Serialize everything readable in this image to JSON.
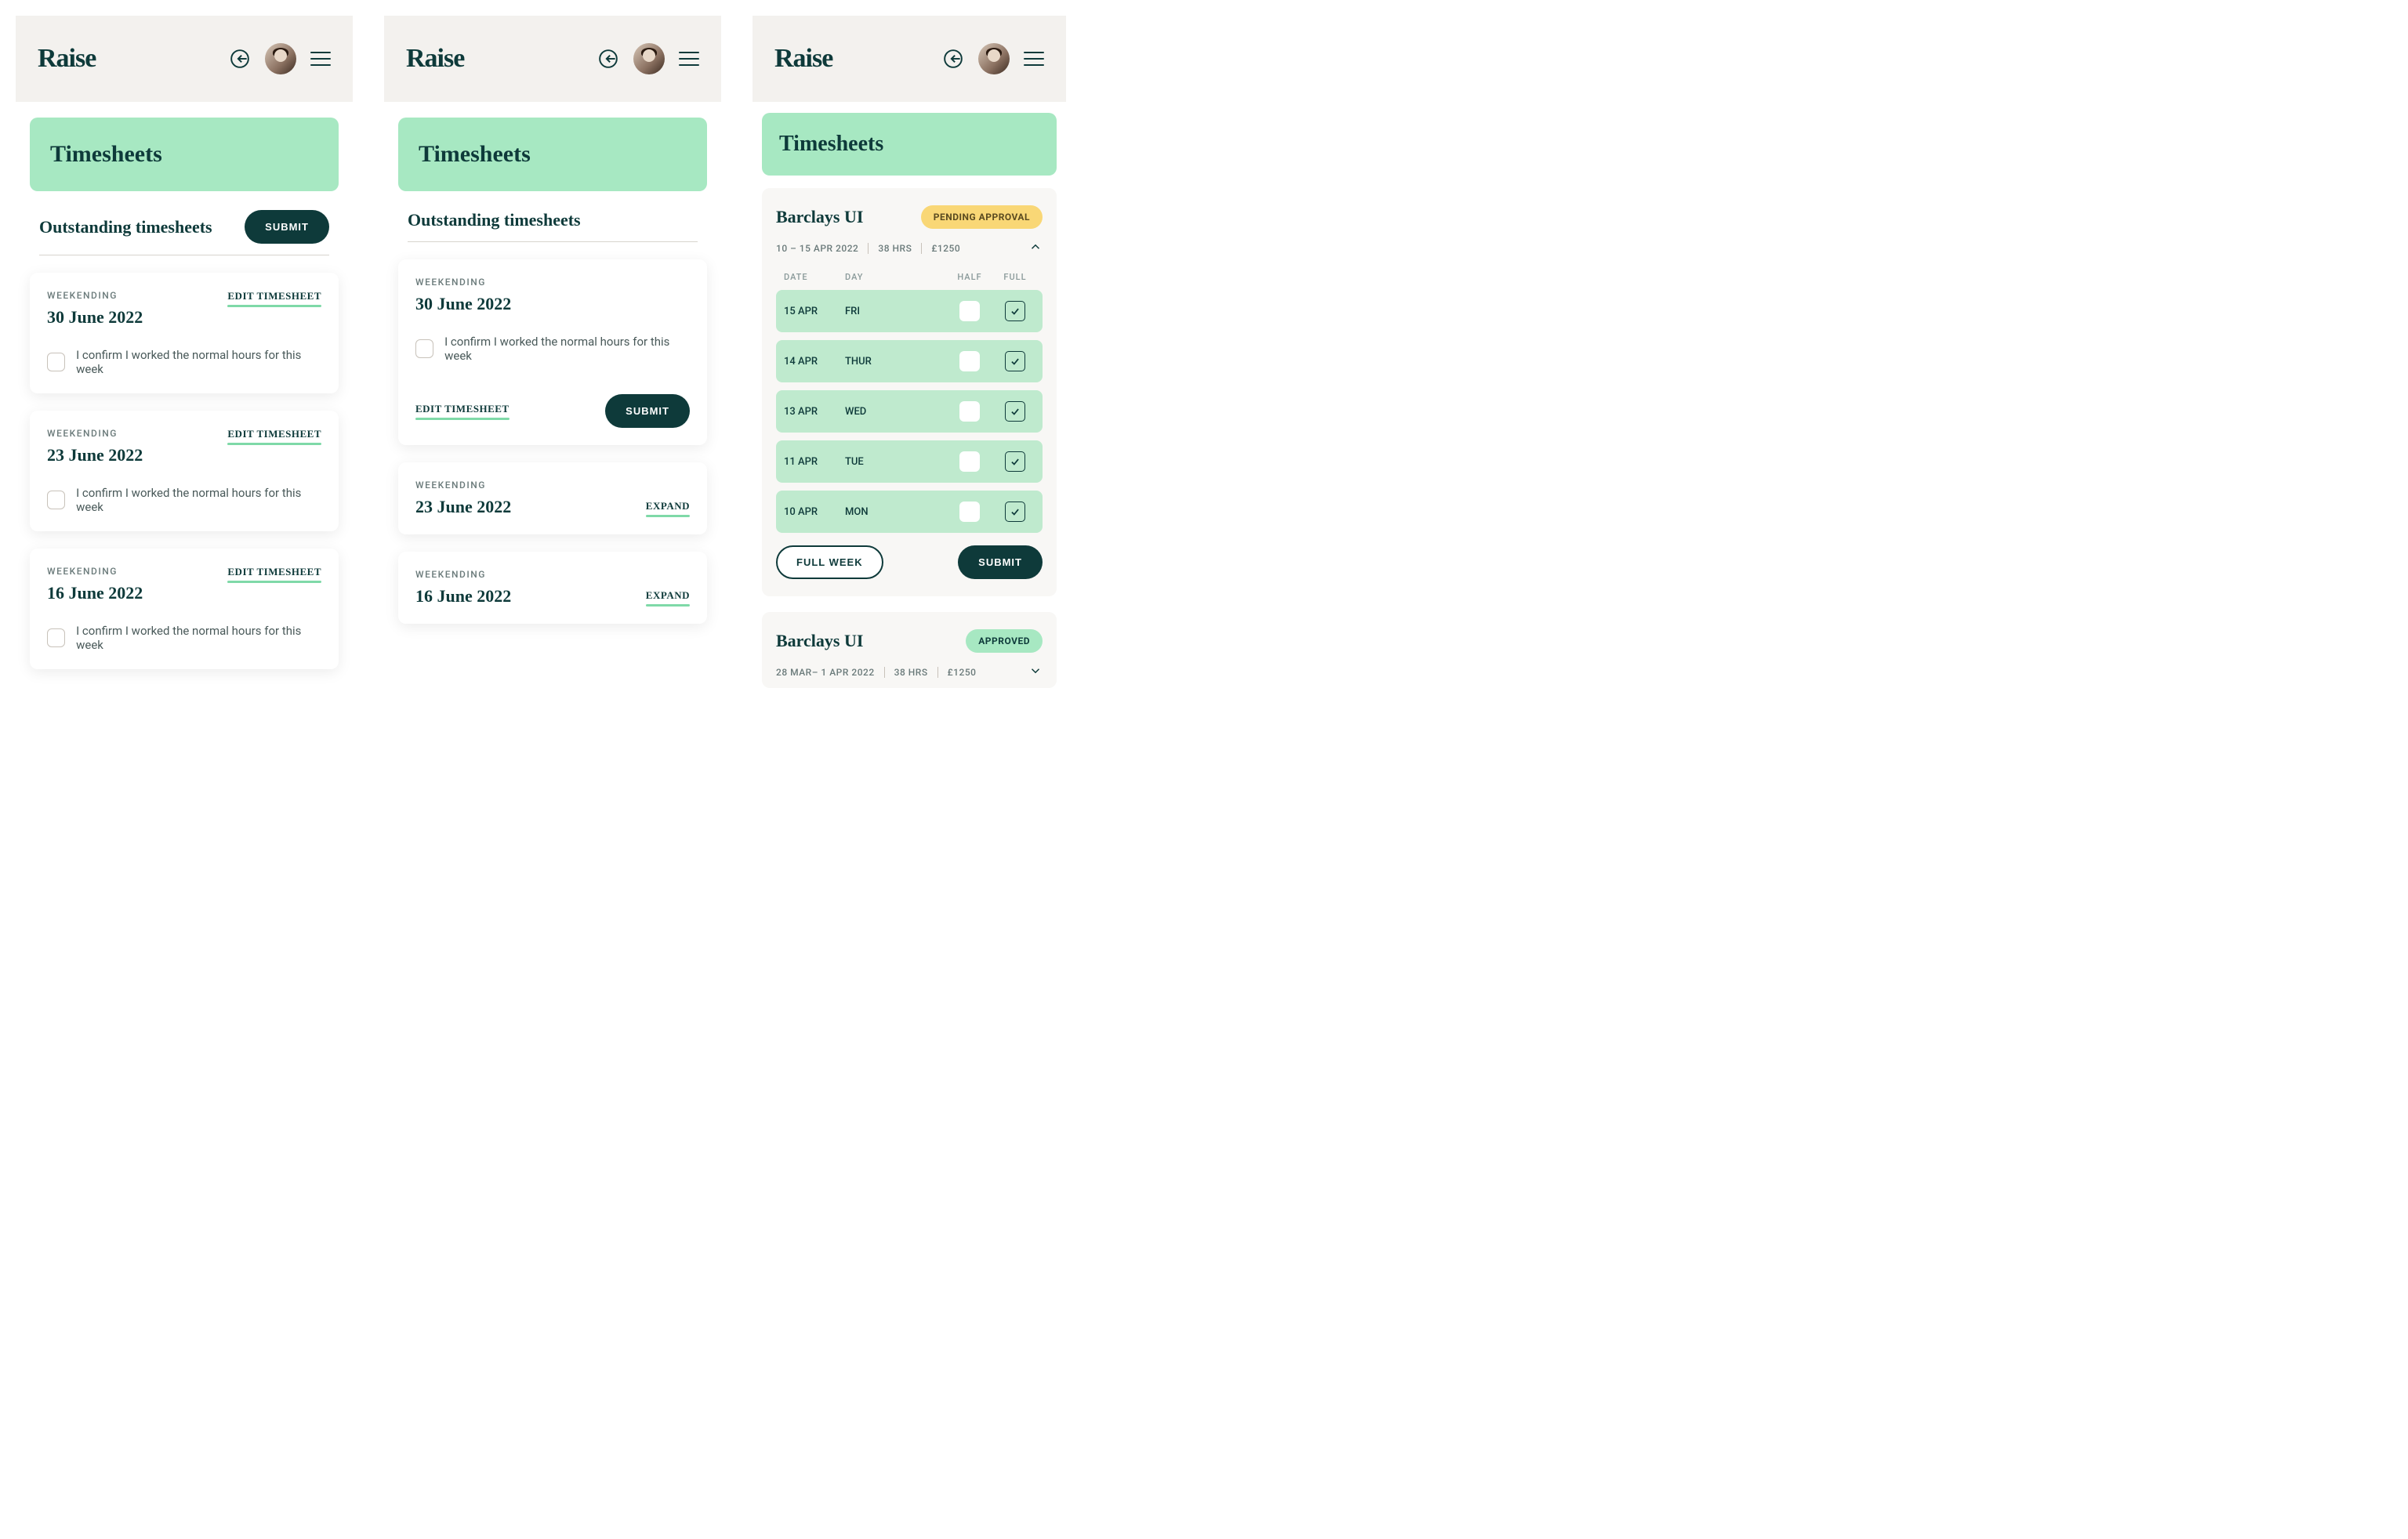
{
  "brand": "Raise",
  "pageTitle": "Timesheets",
  "outstanding": {
    "title": "Outstanding timesheets",
    "submitLabel": "SUBMIT",
    "weekendingLabel": "WEEKENDING",
    "confirmText": "I confirm I worked the normal hours for this week",
    "editLabel": "EDIT TIMESHEET",
    "expandLabel": "EXPAND",
    "weeks": [
      {
        "date": "30 June 2022"
      },
      {
        "date": "23 June 2022"
      },
      {
        "date": "16 June 2022"
      }
    ]
  },
  "detail": {
    "project": "Barclays UI",
    "pendingBadge": "PENDING APPROVAL",
    "approvedBadge": "APPROVED",
    "range1": "10 – 15 APR 2022",
    "range2": "28 MAR– 1 APR 2022",
    "hours": "38 HRS",
    "amount": "£1250",
    "columns": {
      "date": "DATE",
      "day": "DAY",
      "half": "HALF",
      "full": "FULL"
    },
    "rows": [
      {
        "date": "15 APR",
        "day": "FRI"
      },
      {
        "date": "14 APR",
        "day": "THUR"
      },
      {
        "date": "13 APR",
        "day": "WED"
      },
      {
        "date": "11 APR",
        "day": "TUE"
      },
      {
        "date": "10 APR",
        "day": "MON"
      }
    ],
    "fullWeekLabel": "FULL WEEK",
    "submitLabel": "SUBMIT"
  }
}
